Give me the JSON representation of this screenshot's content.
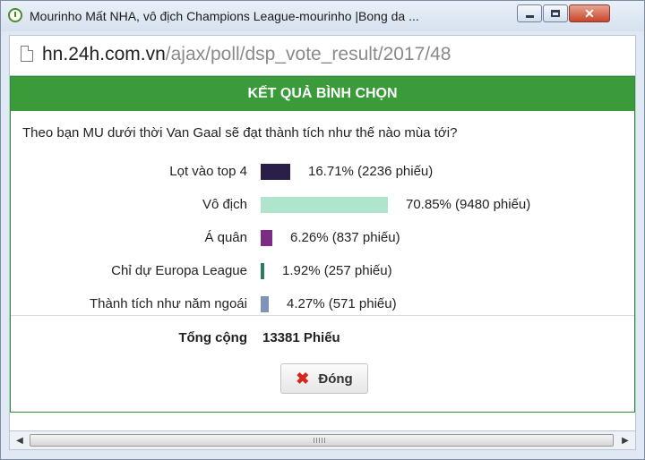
{
  "window": {
    "title": "Mourinho Mất NHA, vô địch Champions League-mourinho |Bong da ..."
  },
  "address": {
    "host": "hn.24h.com.vn",
    "path": "/ajax/poll/dsp_vote_result/2017/48"
  },
  "poll": {
    "header": "KẾT QUẢ BÌNH CHỌN",
    "question": "Theo bạn MU dưới thời Van Gaal sẽ đạt thành tích như thế nào mùa tới?",
    "options": [
      {
        "label": "Lọt vào top 4",
        "result": "16.71% (2236 phiếu)",
        "percent": 16.71,
        "color": "#2a1f49"
      },
      {
        "label": "Vô địch",
        "result": "70.85% (9480 phiếu)",
        "percent": 70.85,
        "color": "#aee5cc"
      },
      {
        "label": "Á quân",
        "result": "6.26% (837 phiếu)",
        "percent": 6.26,
        "color": "#7b2d86"
      },
      {
        "label": "Chỉ dự Europa League",
        "result": "1.92% (257 phiếu)",
        "percent": 1.92,
        "color": "#2f7a66"
      },
      {
        "label": "Thành tích như năm ngoái",
        "result": "4.27% (571 phiếu)",
        "percent": 4.27,
        "color": "#7f93b7"
      }
    ],
    "total_label": "Tổng cộng",
    "total_value": "13381 Phiếu",
    "close_label": "Đóng"
  },
  "colors": {
    "header_green": "#3b9b3b",
    "close_icon": "#d8261c"
  },
  "icons": {
    "app": "clock-icon",
    "page": "page-icon",
    "close_button": "x-icon"
  }
}
